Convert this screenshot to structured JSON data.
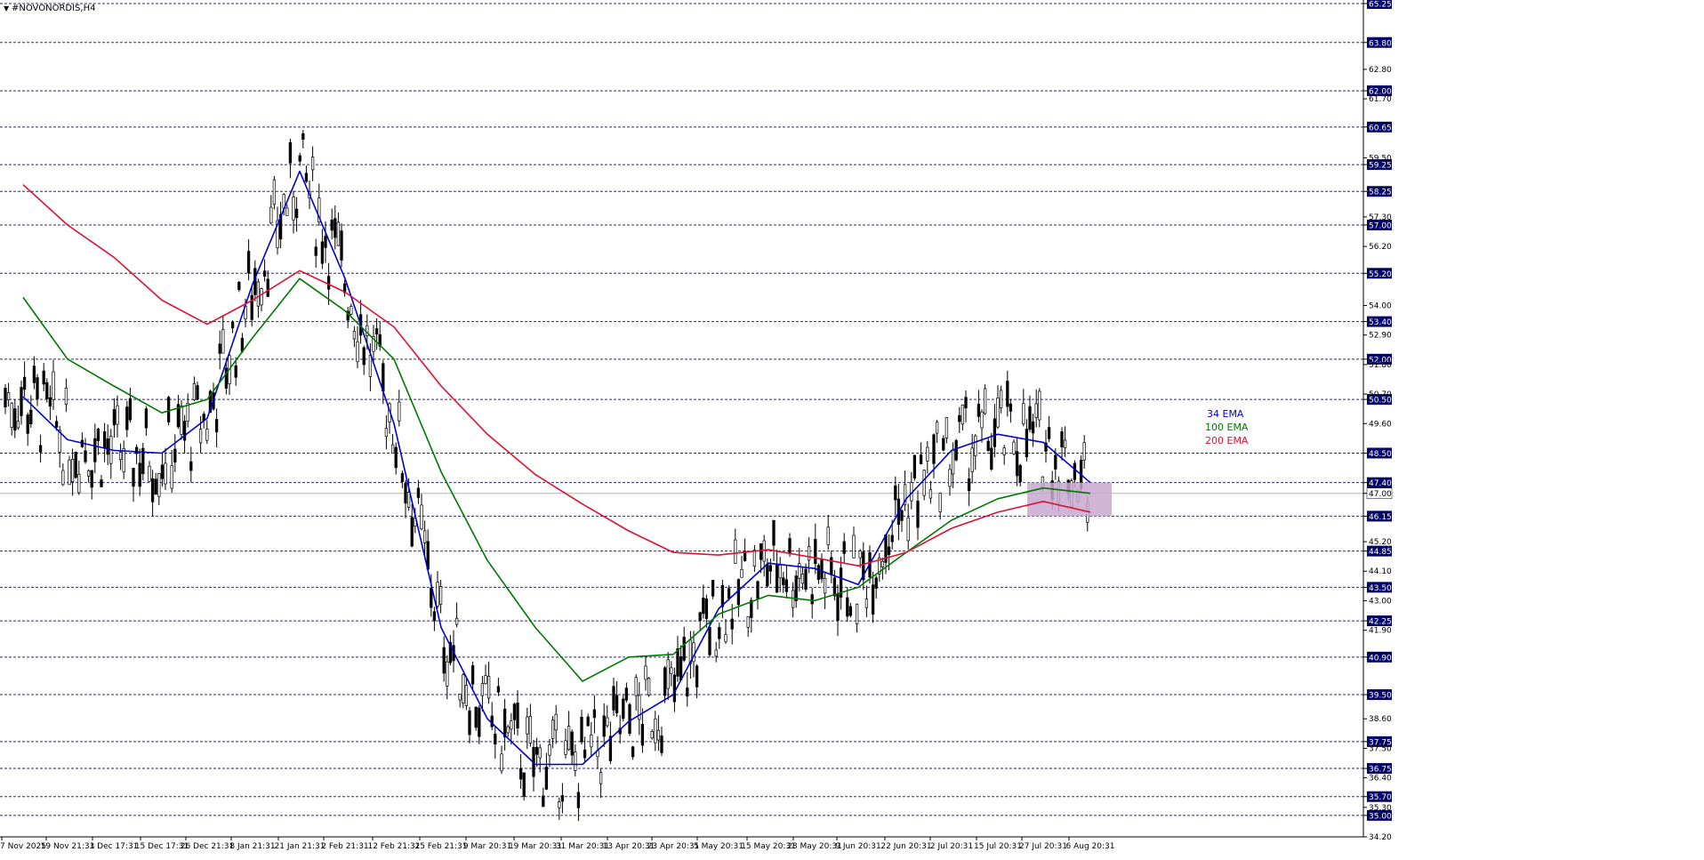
{
  "window": {
    "title": "#NOVONORDIS,H4"
  },
  "colors": {
    "ema34": "#0000cc",
    "ema100": "#007700",
    "ema200": "#dd1133",
    "grid": "#2b2b6a",
    "price_label_bg": "#000066",
    "zone_fill": "#c8a8cf",
    "candle_up": "#ffffff",
    "candle_down": "#000000"
  },
  "chart_data": {
    "type": "candlestick",
    "symbol": "#NOVONORDIS",
    "timeframe": "H4",
    "ylim": [
      34.2,
      65.25
    ],
    "grid": true,
    "y_ticks": [
      "65.25",
      "63.80",
      "62.80",
      "62.00",
      "61.70",
      "60.65",
      "59.50",
      "59.25",
      "58.25",
      "57.30",
      "57.00",
      "56.20",
      "55.20",
      "54.00",
      "53.40",
      "52.90",
      "52.00",
      "51.80",
      "50.70",
      "50.50",
      "49.60",
      "48.50",
      "47.40",
      "47.00",
      "46.15",
      "45.20",
      "44.85",
      "44.10",
      "43.50",
      "43.00",
      "42.25",
      "41.90",
      "40.90",
      "39.50",
      "38.60",
      "37.75",
      "37.50",
      "36.75",
      "36.40",
      "35.70",
      "35.30",
      "35.00",
      "34.20"
    ],
    "labeled_levels": [
      "65.25",
      "63.80",
      "62.00",
      "60.65",
      "59.25",
      "58.25",
      "57.00",
      "55.20",
      "53.40",
      "52.00",
      "50.50",
      "48.50",
      "47.40",
      "47.00",
      "46.15",
      "44.85",
      "43.50",
      "42.25",
      "40.90",
      "39.50",
      "37.75",
      "36.75",
      "35.70",
      "35.00"
    ],
    "current_price": "47.00",
    "x_labels": [
      "7 Nov 2025",
      "19 Nov 21:31",
      "3 Dec 17:31",
      "15 Dec 17:31",
      "26 Dec 21:31",
      "8 Jan 21:31",
      "21 Jan 21:31",
      "2 Feb 21:31",
      "12 Feb 21:31",
      "25 Feb 21:31",
      "9 Mar 20:31",
      "19 Mar 20:31",
      "31 Mar 20:31",
      "13 Apr 20:31",
      "23 Apr 20:31",
      "5 May 20:31",
      "15 May 20:31",
      "28 May 20:31",
      "9 Jun 20:31",
      "22 Jun 20:31",
      "2 Jul 20:31",
      "15 Jul 20:31",
      "27 Jul 20:31",
      "6 Aug 20:31"
    ],
    "series": [
      {
        "name": "34 EMA",
        "x": [
          "7 Nov 2025",
          "19 Nov 21:31",
          "3 Dec 17:31",
          "15 Dec 17:31",
          "26 Dec 21:31",
          "8 Jan 21:31",
          "21 Jan 21:31",
          "2 Feb 21:31",
          "12 Feb 21:31",
          "25 Feb 21:31",
          "9 Mar 20:31",
          "19 Mar 20:31",
          "31 Mar 20:31",
          "13 Apr 20:31",
          "23 Apr 20:31",
          "5 May 20:31",
          "15 May 20:31",
          "28 May 20:31",
          "9 Jun 20:31",
          "22 Jun 20:31",
          "2 Jul 20:31",
          "15 Jul 20:31",
          "27 Jul 20:31",
          "6 Aug 20:31"
        ],
        "values": [
          50.6,
          49.0,
          48.6,
          48.5,
          49.8,
          54.8,
          59.0,
          55.0,
          49.6,
          42.0,
          38.6,
          36.9,
          36.9,
          38.5,
          39.5,
          42.7,
          44.4,
          44.2,
          43.6,
          46.8,
          48.6,
          49.2,
          48.9,
          47.4
        ]
      },
      {
        "name": "100 EMA",
        "x": [
          "7 Nov 2025",
          "19 Nov 21:31",
          "3 Dec 17:31",
          "15 Dec 17:31",
          "26 Dec 21:31",
          "8 Jan 21:31",
          "21 Jan 21:31",
          "2 Feb 21:31",
          "12 Feb 21:31",
          "25 Feb 21:31",
          "9 Mar 20:31",
          "19 Mar 20:31",
          "31 Mar 20:31",
          "13 Apr 20:31",
          "23 Apr 20:31",
          "5 May 20:31",
          "15 May 20:31",
          "28 May 20:31",
          "9 Jun 20:31",
          "22 Jun 20:31",
          "2 Jul 20:31",
          "15 Jul 20:31",
          "27 Jul 20:31",
          "6 Aug 20:31"
        ],
        "values": [
          54.3,
          52.0,
          51.0,
          50.0,
          50.5,
          52.8,
          55.0,
          53.8,
          52.0,
          47.8,
          44.5,
          42.0,
          40.0,
          40.9,
          41.0,
          42.5,
          43.2,
          43.0,
          43.5,
          44.8,
          46.0,
          46.8,
          47.2,
          47.0
        ]
      },
      {
        "name": "200 EMA",
        "x": [
          "7 Nov 2025",
          "19 Nov 21:31",
          "3 Dec 17:31",
          "15 Dec 17:31",
          "26 Dec 21:31",
          "8 Jan 21:31",
          "21 Jan 21:31",
          "2 Feb 21:31",
          "12 Feb 21:31",
          "25 Feb 21:31",
          "9 Mar 20:31",
          "19 Mar 20:31",
          "31 Mar 20:31",
          "13 Apr 20:31",
          "23 Apr 20:31",
          "5 May 20:31",
          "15 May 20:31",
          "28 May 20:31",
          "9 Jun 20:31",
          "22 Jun 20:31",
          "2 Jul 20:31",
          "15 Jul 20:31",
          "27 Jul 20:31",
          "6 Aug 20:31"
        ],
        "values": [
          58.5,
          57.0,
          55.8,
          54.2,
          53.3,
          54.2,
          55.3,
          54.5,
          53.2,
          51.0,
          49.2,
          47.7,
          46.6,
          45.6,
          44.8,
          44.7,
          44.9,
          44.6,
          44.3,
          44.8,
          45.7,
          46.3,
          46.7,
          46.3
        ]
      }
    ],
    "annotations": [
      {
        "text": "34 EMA",
        "color": "#0000cc"
      },
      {
        "text": "100 EMA",
        "color": "#007700"
      },
      {
        "text": "200 EMA",
        "color": "#dd1133"
      }
    ],
    "highlight_zone": {
      "x_from": "27 Jul 20:31",
      "x_to": "6 Aug 20:31",
      "y_from": 46.15,
      "y_to": 47.4
    }
  }
}
